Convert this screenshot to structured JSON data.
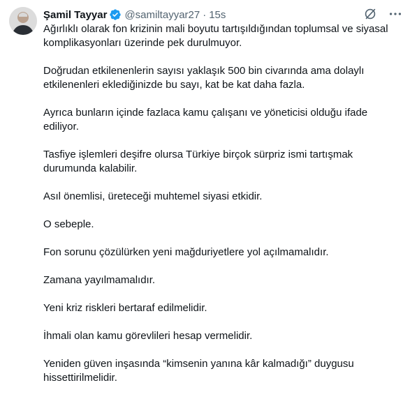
{
  "author": {
    "name": "Şamil Tayyar",
    "handle": "@samiltayyar27",
    "separator": "·",
    "time": "15s"
  },
  "icons": {
    "verified": "verified-badge-icon",
    "grok": "grok-icon",
    "more": "more-options-icon",
    "verified_color": "#1d9bf0"
  },
  "tweet": {
    "paragraphs": [
      "Ağırlıklı olarak fon krizinin mali boyutu tartışıldığından toplumsal ve siyasal komplikasyonları üzerinde pek durulmuyor.",
      "Doğrudan etkilenenlerin sayısı yaklaşık 500 bin civarında ama dolaylı etkilenenleri eklediğinizde bu sayı, kat be kat daha fazla.",
      "Ayrıca bunların içinde fazlaca kamu çalışanı ve yöneticisi olduğu ifade ediliyor.",
      "Tasfiye işlemleri deşifre olursa Türkiye birçok sürpriz ismi tartışmak durumunda kalabilir.",
      "Asıl önemlisi, üreteceği muhtemel siyasi etkidir.",
      "O sebeple.",
      "Fon sorunu çözülürken yeni mağduriyetlere yol açılmamalıdır.",
      "Zamana yayılmamalıdır.",
      "Yeni kriz riskleri bertaraf edilmelidir.",
      "İhmali olan kamu görevlileri hesap vermelidir.",
      "Yeniden güven inşasında “kimsenin yanına kâr kalmadığı” duygusu hissettirilmelidir."
    ]
  }
}
